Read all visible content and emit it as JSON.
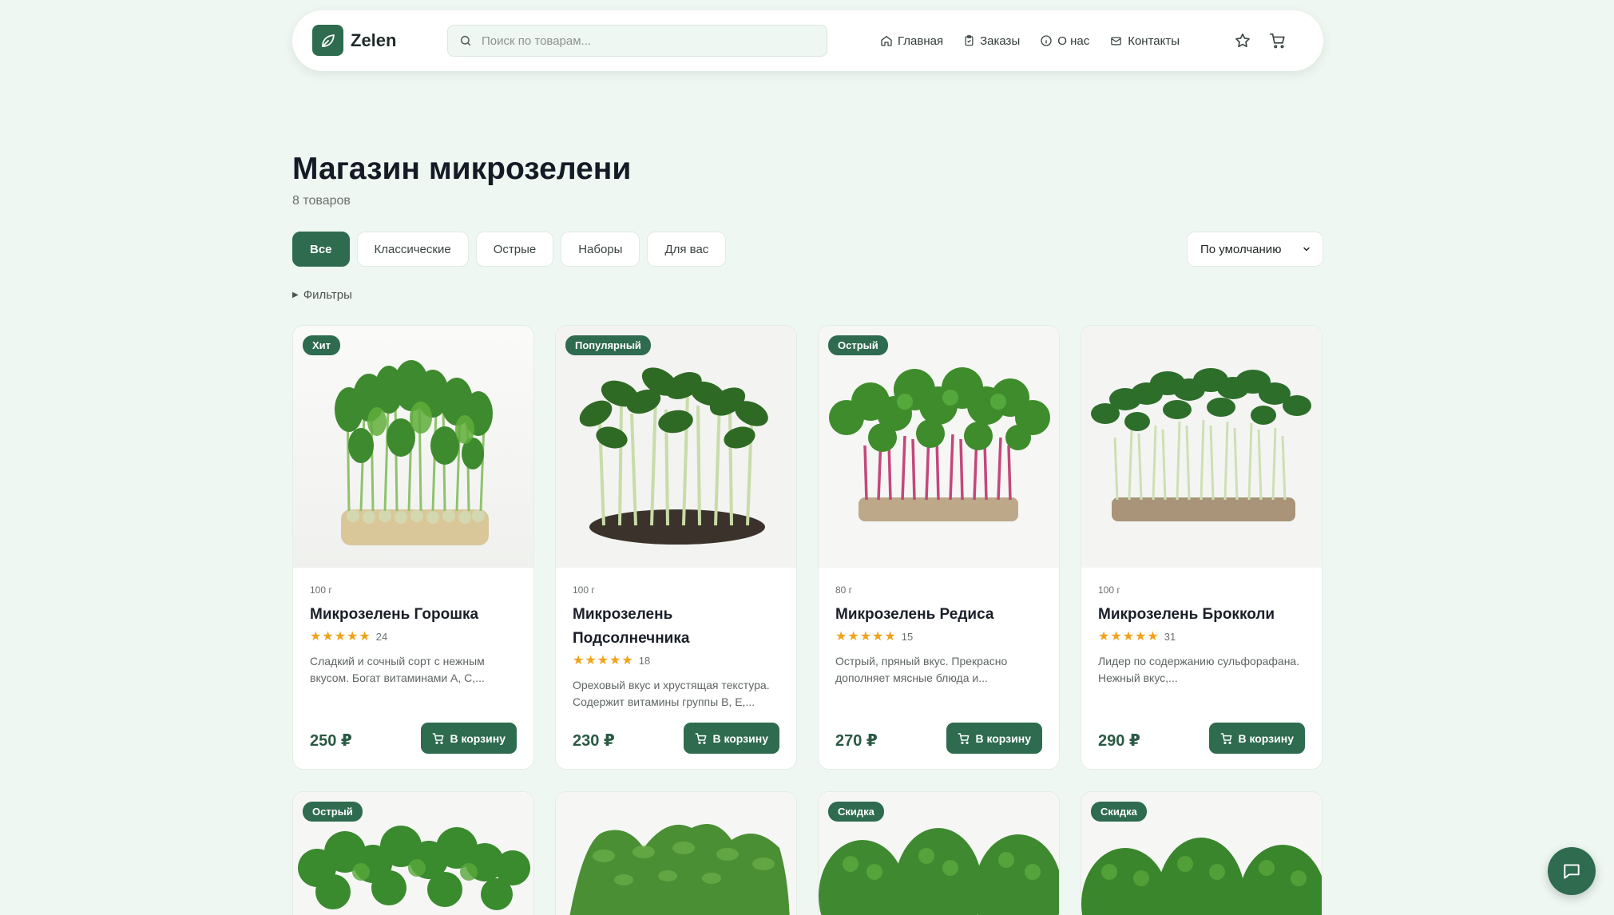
{
  "header": {
    "logo_text": "Zelen",
    "search_placeholder": "Поиск по товарам...",
    "nav": [
      {
        "label": "Главная",
        "icon": "home-icon"
      },
      {
        "label": "Заказы",
        "icon": "clipboard-icon"
      },
      {
        "label": "О нас",
        "icon": "info-icon"
      },
      {
        "label": "Контакты",
        "icon": "mail-icon"
      }
    ],
    "icons": [
      "star-icon",
      "cart-icon"
    ]
  },
  "page": {
    "title": "Магазин микрозелени",
    "count": "8 товаров"
  },
  "categories": [
    "Все",
    "Классические",
    "Острые",
    "Наборы",
    "Для вас"
  ],
  "active_category": "Все",
  "sort": {
    "selected": "По умолчанию"
  },
  "filters_label": "Фильтры",
  "cart_label": "В корзину",
  "products": [
    {
      "badge": "Хит",
      "weight": "100 г",
      "name": "Микрозелень Горошка",
      "rating": 5,
      "reviews": "24",
      "desc": "Сладкий и сочный сорт с нежным вкусом. Богат витаминами A, C,...",
      "price": "250 ₽"
    },
    {
      "badge": "Популярный",
      "weight": "100 г",
      "name": "Микрозелень Подсолнечника",
      "rating": 5,
      "reviews": "18",
      "desc": "Ореховый вкус и хрустящая текстура. Содержит витамины группы B, E,...",
      "price": "230 ₽"
    },
    {
      "badge": "Острый",
      "weight": "80 г",
      "name": "Микрозелень Редиса",
      "rating": 5,
      "reviews": "15",
      "desc": "Острый, пряный вкус. Прекрасно дополняет мясные блюда и...",
      "price": "270 ₽"
    },
    {
      "badge": "",
      "weight": "100 г",
      "name": "Микрозелень Брокколи",
      "rating": 5,
      "reviews": "31",
      "desc": "Лидер по содержанию сульфорафана. Нежный вкус,...",
      "price": "290 ₽"
    }
  ],
  "products_row2_badges": [
    "Острый",
    "",
    "Скидка",
    "Скидка"
  ],
  "colors": {
    "accent": "#2e6b4f",
    "background": "#eef7f1",
    "star": "#f0a21a",
    "price": "#2a5a44"
  }
}
